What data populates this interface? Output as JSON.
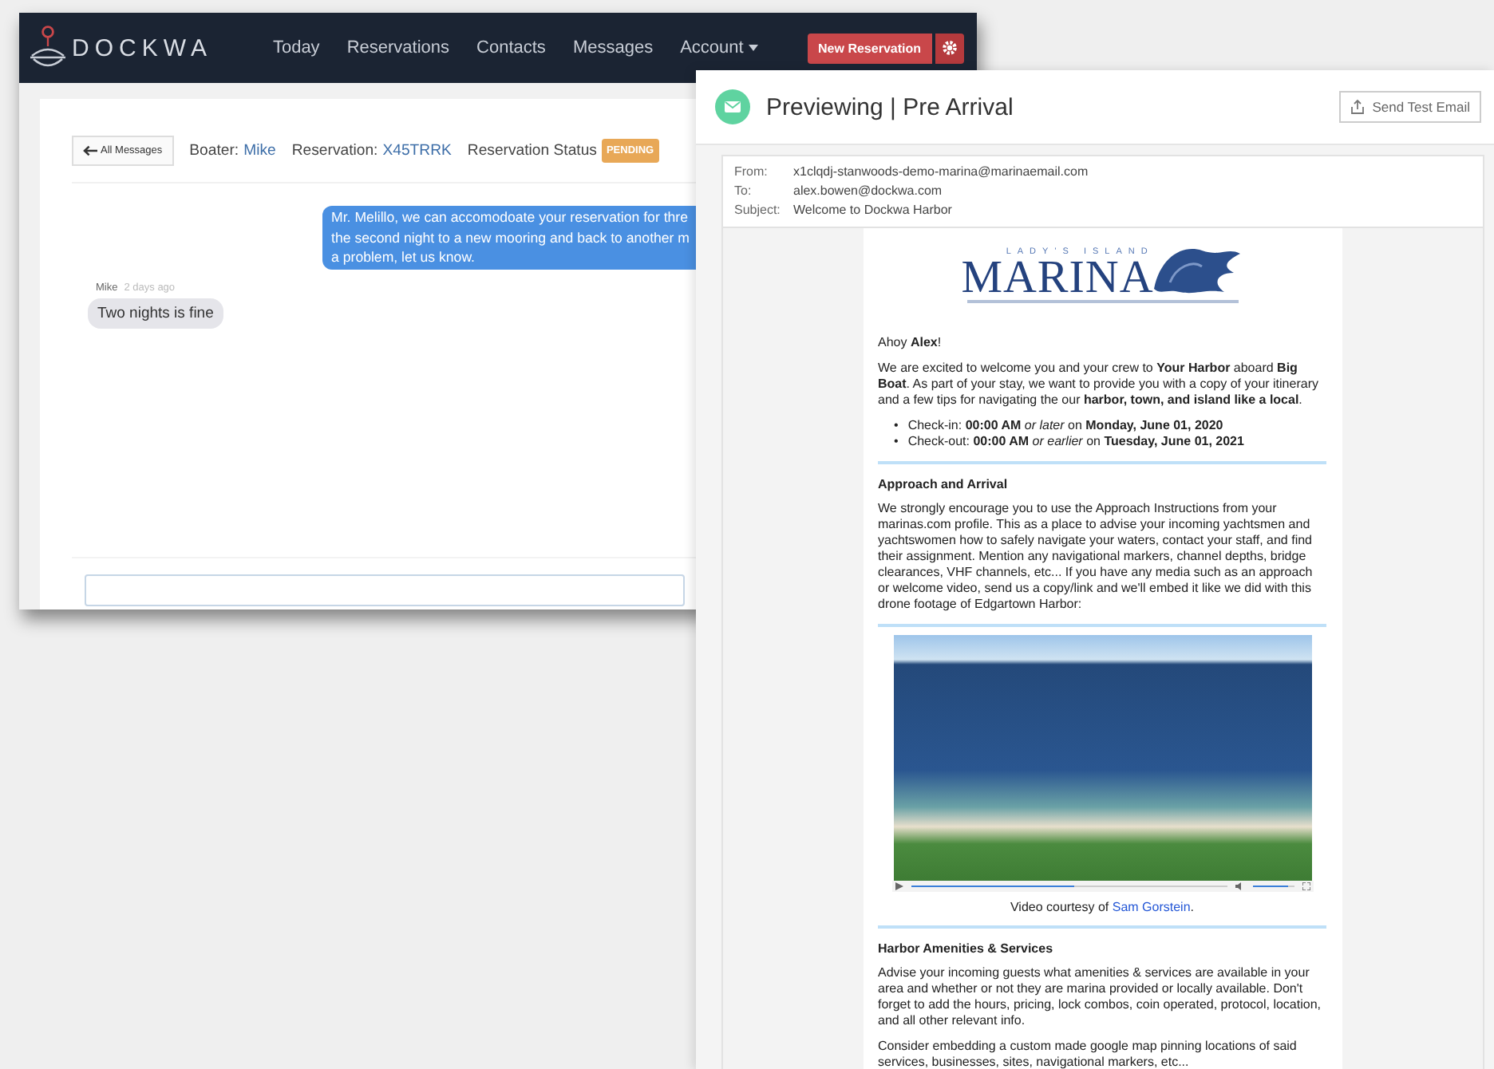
{
  "messaging_window": {
    "nav": {
      "brand": "DOCKWA",
      "links": [
        {
          "label": "Today",
          "dropdown": false
        },
        {
          "label": "Reservations",
          "dropdown": false
        },
        {
          "label": "Contacts",
          "dropdown": false
        },
        {
          "label": "Messages",
          "dropdown": false
        },
        {
          "label": "Account",
          "dropdown": true
        }
      ],
      "new_button": "New Reservation"
    },
    "header": {
      "back_button": "All Messages",
      "boater_label": "Boater:",
      "boater": "Mike",
      "reservation_label": "Reservation:",
      "reservation": "X45TRRK",
      "status_label": "Reservation Status",
      "status": "PENDING"
    },
    "messages": [
      {
        "kind": "outgoing",
        "lines": [
          "Mr. Melillo, we can accomodoate your reservation for thre",
          "the second night to a new mooring and back to another m",
          "a problem, let us know."
        ]
      },
      {
        "kind": "incoming",
        "author": "Mike",
        "time": "2 days ago",
        "lines": [
          "Two nights is fine"
        ]
      }
    ]
  },
  "preview_window": {
    "title": "Previewing | Pre Arrival",
    "send_button": "Send Test Email",
    "headers": [
      {
        "label": "From:",
        "value": "x1clqdj-stanwoods-demo-marina@marinaemail.com"
      },
      {
        "label": "To:",
        "value": "alex.bowen@dockwa.com"
      },
      {
        "label": "Subject:",
        "value": "Welcome to Dockwa Harbor"
      }
    ],
    "email": {
      "logo": {
        "tagline": "LADY'S ISLAND",
        "name": "MARINA"
      },
      "blocks": [
        {
          "kind": "text",
          "text": "Ahoy **Alex**!"
        },
        {
          "kind": "text",
          "text": "We are excited to welcome you and your crew to **Your Harbor** aboard **Big Boat**. As part of your stay, we want to provide you with a copy of your itinerary and a few tips for navigating the our **harbor, town, and island like a local**."
        },
        {
          "kind": "list",
          "marker": "•",
          "items": [
            "Check-in: **00:00 AM** *or later* on **Monday, June 01, 2020**",
            "Check-out: **00:00 AM** *or earlier* on **Tuesday, June 01, 2021**"
          ]
        },
        {
          "kind": "rule"
        },
        {
          "kind": "heading",
          "text": "Approach and Arrival"
        },
        {
          "kind": "text",
          "text": "We strongly encourage you to use the Approach Instructions from your marinas.com profile. This as a place to advise your incoming yachtsmen and yachtswomen how to safely navigate your waters, contact your staff, and find their assignment. Mention any navigational markers, channel depths, bridge clearances, VHF channels, etc... If you have any media such as an approach or welcome video, send us a copy/link and we'll embed it like we did with this drone footage of Edgartown Harbor:"
        },
        {
          "kind": "rule"
        },
        {
          "kind": "video",
          "progress": {
            "level": 0.52
          },
          "volume": {
            "level": 0.85
          },
          "caption_before": "Video courtesy of ",
          "credit": "Sam Gorstein",
          "caption_after": "."
        },
        {
          "kind": "rule"
        },
        {
          "kind": "heading",
          "text": "Harbor Amenities & Services"
        },
        {
          "kind": "text",
          "text": "Advise your incoming guests what amenities & services are available in your area and whether or not they are marina provided or locally available. Don't forget to add the hours, pricing, lock combos, coin operated, protocol, location, and all other relevant info."
        },
        {
          "kind": "text",
          "text": "Consider embedding a custom made google map pinning locations of said services, businesses, sites, navigational markers, etc..."
        }
      ]
    }
  }
}
